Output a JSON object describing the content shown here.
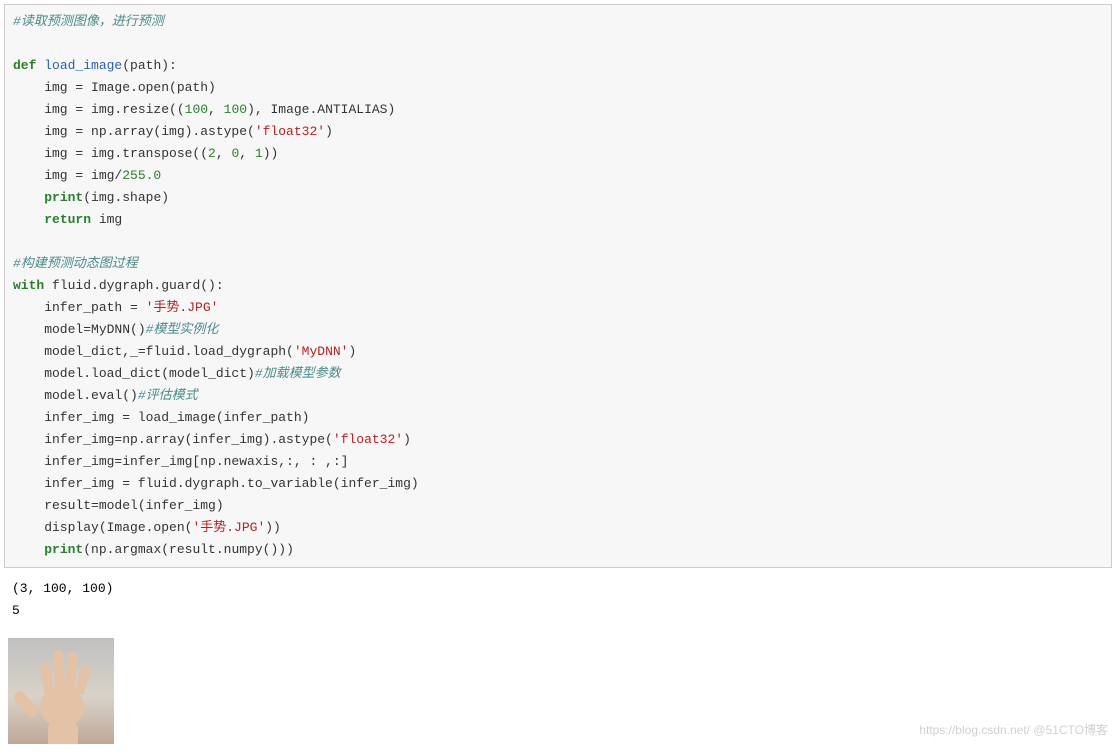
{
  "code_tokens": [
    [
      [
        "comment",
        "#读取预测图像，进行预测"
      ]
    ],
    [],
    [
      [
        "keyword",
        "def"
      ],
      [
        "plain",
        " "
      ],
      [
        "funcname",
        "load_image"
      ],
      [
        "plain",
        "(path):"
      ]
    ],
    [
      [
        "plain",
        "    img = Image.open(path)"
      ]
    ],
    [
      [
        "plain",
        "    img = img.resize(("
      ],
      [
        "num",
        "100"
      ],
      [
        "plain",
        ", "
      ],
      [
        "num",
        "100"
      ],
      [
        "plain",
        "), Image.ANTIALIAS)"
      ]
    ],
    [
      [
        "plain",
        "    img = np.array(img).astype("
      ],
      [
        "string",
        "'float32'"
      ],
      [
        "plain",
        ")"
      ]
    ],
    [
      [
        "plain",
        "    img = img.transpose(("
      ],
      [
        "num",
        "2"
      ],
      [
        "plain",
        ", "
      ],
      [
        "num",
        "0"
      ],
      [
        "plain",
        ", "
      ],
      [
        "num",
        "1"
      ],
      [
        "plain",
        "))"
      ]
    ],
    [
      [
        "plain",
        "    img = img/"
      ],
      [
        "num",
        "255.0"
      ]
    ],
    [
      [
        "plain",
        "    "
      ],
      [
        "keyword",
        "print"
      ],
      [
        "plain",
        "(img.shape)"
      ]
    ],
    [
      [
        "plain",
        "    "
      ],
      [
        "keyword",
        "return"
      ],
      [
        "plain",
        " img"
      ]
    ],
    [],
    [
      [
        "comment",
        "#构建预测动态图过程"
      ]
    ],
    [
      [
        "keyword",
        "with"
      ],
      [
        "plain",
        " fluid.dygraph.guard():"
      ]
    ],
    [
      [
        "plain",
        "    infer_path = "
      ],
      [
        "string",
        "'手势.JPG'"
      ]
    ],
    [
      [
        "plain",
        "    model=MyDNN()"
      ],
      [
        "comment",
        "#模型实例化"
      ]
    ],
    [
      [
        "plain",
        "    model_dict,_=fluid.load_dygraph("
      ],
      [
        "string",
        "'MyDNN'"
      ],
      [
        "plain",
        ")"
      ]
    ],
    [
      [
        "plain",
        "    model.load_dict(model_dict)"
      ],
      [
        "comment",
        "#加载模型参数"
      ]
    ],
    [
      [
        "plain",
        "    model.eval()"
      ],
      [
        "comment",
        "#评估模式"
      ]
    ],
    [
      [
        "plain",
        "    infer_img = load_image(infer_path)"
      ]
    ],
    [
      [
        "plain",
        "    infer_img=np.array(infer_img).astype("
      ],
      [
        "string",
        "'float32'"
      ],
      [
        "plain",
        ")"
      ]
    ],
    [
      [
        "plain",
        "    infer_img=infer_img[np.newaxis,:, : ,:]"
      ]
    ],
    [
      [
        "plain",
        "    infer_img = fluid.dygraph.to_variable(infer_img)"
      ]
    ],
    [
      [
        "plain",
        "    result=model(infer_img)"
      ]
    ],
    [
      [
        "plain",
        "    display(Image.open("
      ],
      [
        "string",
        "'手势.JPG'"
      ],
      [
        "plain",
        "))"
      ]
    ],
    [
      [
        "plain",
        "    "
      ],
      [
        "keyword",
        "print"
      ],
      [
        "plain",
        "(np.argmax(result.numpy()))"
      ]
    ]
  ],
  "output_lines": [
    "(3, 100, 100)",
    "5"
  ],
  "watermark": "https://blog.csdn.net/ @51CTO博客"
}
